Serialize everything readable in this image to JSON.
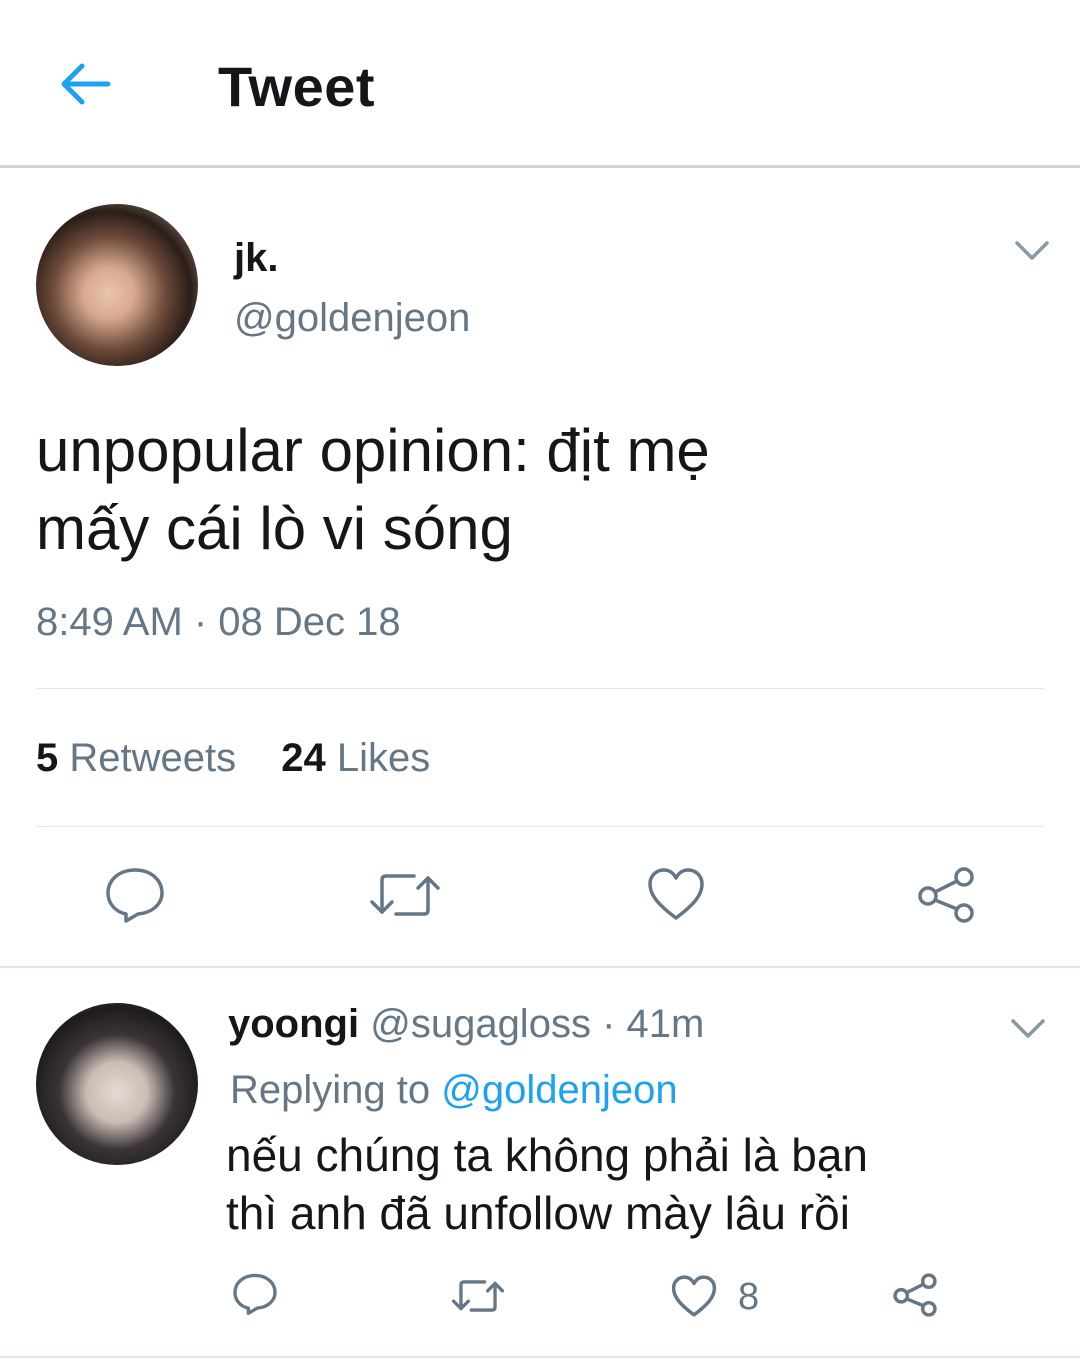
{
  "header": {
    "title": "Tweet",
    "back_icon": "arrow-left-icon",
    "accent_color": "#1da1f2"
  },
  "tweet": {
    "display_name": "jk.",
    "handle": "@goldenjeon",
    "text_line1": "unpopular opinion: địt mẹ",
    "text_line2": "mấy cái lò vi sóng",
    "timestamp": "8:49 AM · 08 Dec 18",
    "retweets_count": "5",
    "retweets_label": "Retweets",
    "likes_count": "24",
    "likes_label": "Likes",
    "actions": [
      "reply-icon",
      "retweet-icon",
      "like-icon",
      "share-icon"
    ]
  },
  "reply": {
    "display_name": "yoongi",
    "handle": "@sugagloss",
    "time": "· 41m",
    "replying_to_label": "Replying to",
    "replying_to_handle": "@goldenjeon",
    "text_line1": "nếu chúng ta không phải là bạn",
    "text_line2": "thì anh đã unfollow mày lâu rồi",
    "like_count": "8",
    "actions": [
      "reply-icon",
      "retweet-icon",
      "like-icon",
      "share-icon"
    ]
  }
}
